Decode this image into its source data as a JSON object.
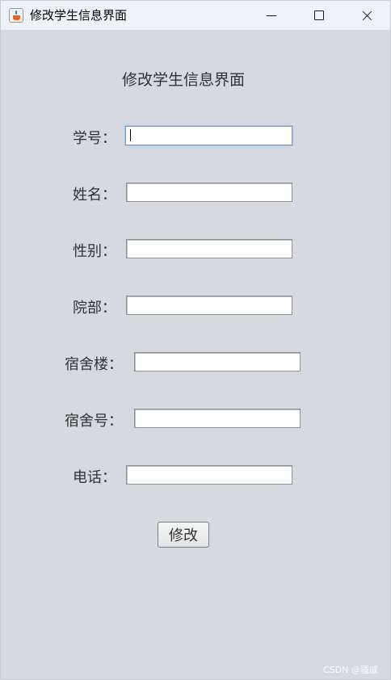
{
  "window": {
    "title": "修改学生信息界面",
    "icon": "java-cup-icon"
  },
  "form": {
    "heading": "修改学生信息界面",
    "fields": [
      {
        "label": "学号：",
        "value": "",
        "focused": true
      },
      {
        "label": "姓名：",
        "value": ""
      },
      {
        "label": "性别：",
        "value": ""
      },
      {
        "label": "院部：",
        "value": ""
      },
      {
        "label": "宿舍楼：",
        "value": ""
      },
      {
        "label": "宿舍号：",
        "value": ""
      },
      {
        "label": "电话：",
        "value": ""
      }
    ],
    "submit_label": "修改"
  },
  "watermark": "CSDN @骚戚",
  "colors": {
    "window_bg": "#d6d9df",
    "titlebar_bg": "#eef1f6",
    "text": "#333333",
    "focus_border": "#7a9cc8"
  }
}
